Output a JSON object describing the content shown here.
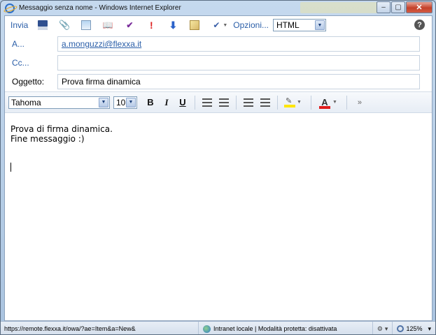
{
  "window": {
    "title": "Messaggio senza nome - Windows Internet Explorer",
    "buttons": {
      "minimize": "–",
      "maximize": "▢",
      "close": "✕"
    }
  },
  "toolbar": {
    "send_label": "Invia",
    "options_label": "Opzioni...",
    "format_value": "HTML",
    "help_label": "?"
  },
  "header": {
    "to": {
      "label": "A...",
      "value": "a.monguzzi@flexxa.it"
    },
    "cc": {
      "label": "Cc...",
      "value": ""
    },
    "subject": {
      "label": "Oggetto:",
      "value": "Prova firma dinamica"
    }
  },
  "formatting": {
    "font": "Tahoma",
    "size": "10",
    "bold": "B",
    "italic": "I",
    "underline": "U",
    "font_color_letter": "A",
    "more": "»"
  },
  "message": {
    "line1": "Prova di firma dinamica.",
    "line2": "Fine messaggio :)"
  },
  "statusbar": {
    "url": "https://remote.flexxa.it/owa/?ae=Item&a=New&",
    "zone": "Intranet locale | Modalità protetta: disattivata",
    "zoom": "125%"
  }
}
